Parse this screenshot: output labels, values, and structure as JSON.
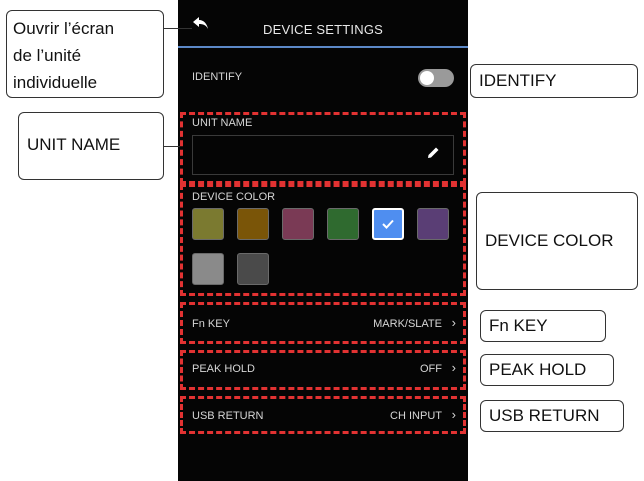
{
  "screen": {
    "title": "DEVICE SETTINGS",
    "identify": {
      "label": "IDENTIFY",
      "on": false
    },
    "unit_name": {
      "label": "UNIT NAME",
      "value": ""
    },
    "device_color": {
      "label": "DEVICE COLOR",
      "swatches": [
        "#7b7a30",
        "#7a5508",
        "#7a3a55",
        "#2f6a2f",
        "#4f8ef0",
        "#5a3e75",
        "#8a8a8a",
        "#4a4a4a"
      ],
      "selected_index": 4
    },
    "fn_key": {
      "label": "Fn KEY",
      "value": "MARK/SLATE"
    },
    "peak_hold": {
      "label": "PEAK HOLD",
      "value": "OFF"
    },
    "usb_return": {
      "label": "USB RETURN",
      "value": "CH INPUT"
    }
  },
  "callouts": {
    "back": "Ouvrir l’écran\nde l’unité\nindividuelle",
    "identify": "IDENTIFY",
    "unit_name": "UNIT NAME",
    "device_color": "DEVICE COLOR",
    "fn_key": "Fn KEY",
    "peak_hold": "PEAK HOLD",
    "usb_return": "USB RETURN"
  },
  "colors": {
    "highlight": "#e23232",
    "accent": "#5c88c7"
  },
  "icons": [
    "back-arrow-icon",
    "pencil-icon",
    "check-icon",
    "chevron-right-icon"
  ]
}
